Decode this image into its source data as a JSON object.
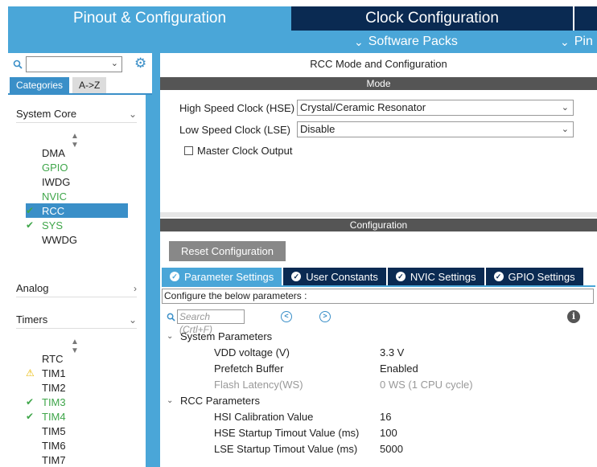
{
  "top_tabs": {
    "pinout": "Pinout & Configuration",
    "clock": "Clock Configuration"
  },
  "subbar": {
    "software_packs": "Software Packs",
    "pinout_truncated": "Pin"
  },
  "left": {
    "search_value": "",
    "tab_categories": "Categories",
    "tab_az": "A->Z",
    "system_core": {
      "title": "System Core",
      "items": [
        {
          "label": "DMA",
          "state": "normal"
        },
        {
          "label": "GPIO",
          "state": "green"
        },
        {
          "label": "IWDG",
          "state": "normal"
        },
        {
          "label": "NVIC",
          "state": "green"
        },
        {
          "label": "RCC",
          "state": "selected"
        },
        {
          "label": "SYS",
          "state": "check"
        },
        {
          "label": "WWDG",
          "state": "normal"
        }
      ]
    },
    "analog": {
      "title": "Analog"
    },
    "timers": {
      "title": "Timers",
      "items": [
        {
          "label": "RTC",
          "state": "normal"
        },
        {
          "label": "TIM1",
          "state": "warning"
        },
        {
          "label": "TIM2",
          "state": "normal"
        },
        {
          "label": "TIM3",
          "state": "check"
        },
        {
          "label": "TIM4",
          "state": "check"
        },
        {
          "label": "TIM5",
          "state": "normal"
        },
        {
          "label": "TIM6",
          "state": "normal"
        },
        {
          "label": "TIM7",
          "state": "normal"
        }
      ]
    }
  },
  "right": {
    "title": "RCC Mode and Configuration",
    "mode_bar": "Mode",
    "hse_label": "High Speed Clock (HSE)",
    "hse_value": "Crystal/Ceramic Resonator",
    "lse_label": "Low Speed Clock (LSE)",
    "lse_value": "Disable",
    "mco_label": "Master Clock Output",
    "config_bar": "Configuration",
    "reset_label": "Reset Configuration",
    "tabs": [
      "Parameter Settings",
      "User Constants",
      "NVIC Settings",
      "GPIO Settings"
    ],
    "configure_text": "Configure the below parameters :",
    "search_placeholder": "Search (Crtl+F)",
    "groups": [
      {
        "title": "System Parameters",
        "params": [
          {
            "name": "VDD voltage (V)",
            "value": "3.3 V",
            "disabled": false
          },
          {
            "name": "Prefetch Buffer",
            "value": "Enabled",
            "disabled": false
          },
          {
            "name": "Flash Latency(WS)",
            "value": "0 WS (1 CPU cycle)",
            "disabled": true
          }
        ]
      },
      {
        "title": "RCC Parameters",
        "params": [
          {
            "name": "HSI Calibration Value",
            "value": "16",
            "disabled": false
          },
          {
            "name": "HSE Startup Timout Value (ms)",
            "value": "100",
            "disabled": false
          },
          {
            "name": "LSE Startup Timout Value (ms)",
            "value": "5000",
            "disabled": false
          }
        ]
      }
    ]
  },
  "colors": {
    "accent": "#4aa6d8",
    "dark": "#0a2a52",
    "green": "#3fa64a",
    "warning": "#e8b800"
  }
}
